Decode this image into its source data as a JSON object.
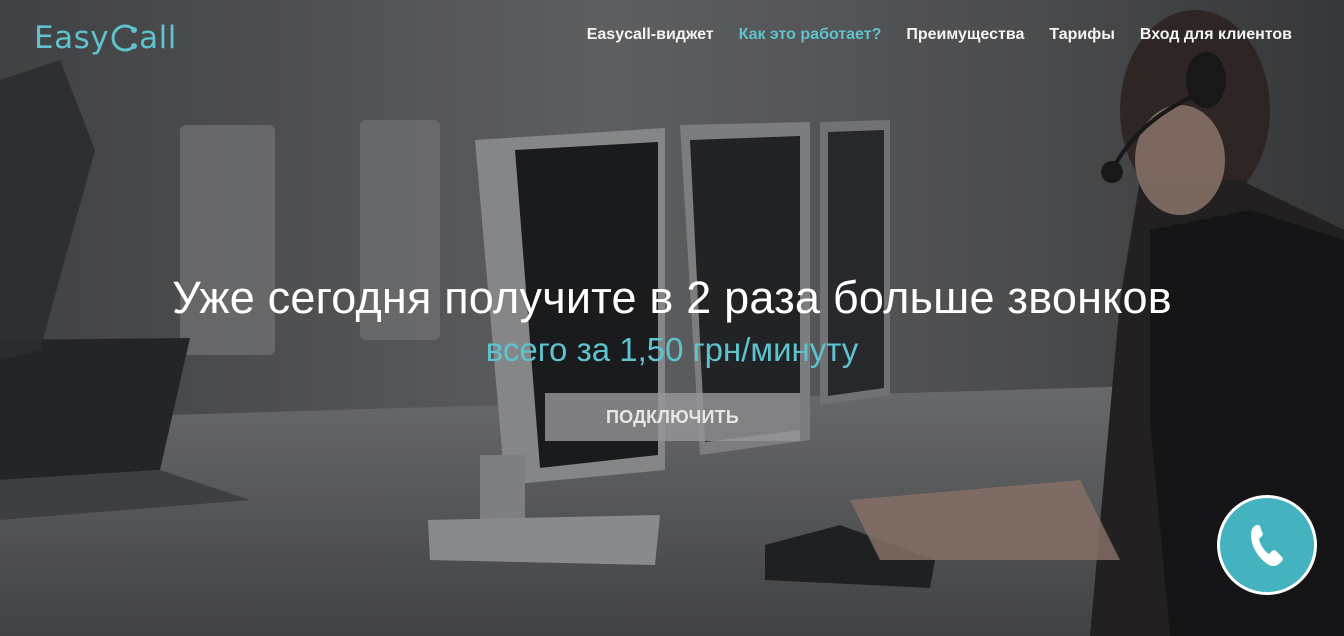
{
  "brand": {
    "logo_prefix": "Easy",
    "logo_suffix": "all",
    "accent_color": "#5ec2cf"
  },
  "nav": {
    "items": [
      {
        "label": "Easycall-виджет",
        "active": false
      },
      {
        "label": "Как это работает?",
        "active": true
      },
      {
        "label": "Преимущества",
        "active": false
      },
      {
        "label": "Тарифы",
        "active": false
      },
      {
        "label": "Вход для клиентов",
        "active": false
      }
    ]
  },
  "hero": {
    "title": "Уже сегодня получите в 2 раза больше звонков",
    "subtitle": "всего за 1,50 грн/минуту",
    "cta_label": "ПОДКЛЮЧИТЬ"
  },
  "widget": {
    "icon": "phone-icon",
    "color": "#45b3bf"
  }
}
